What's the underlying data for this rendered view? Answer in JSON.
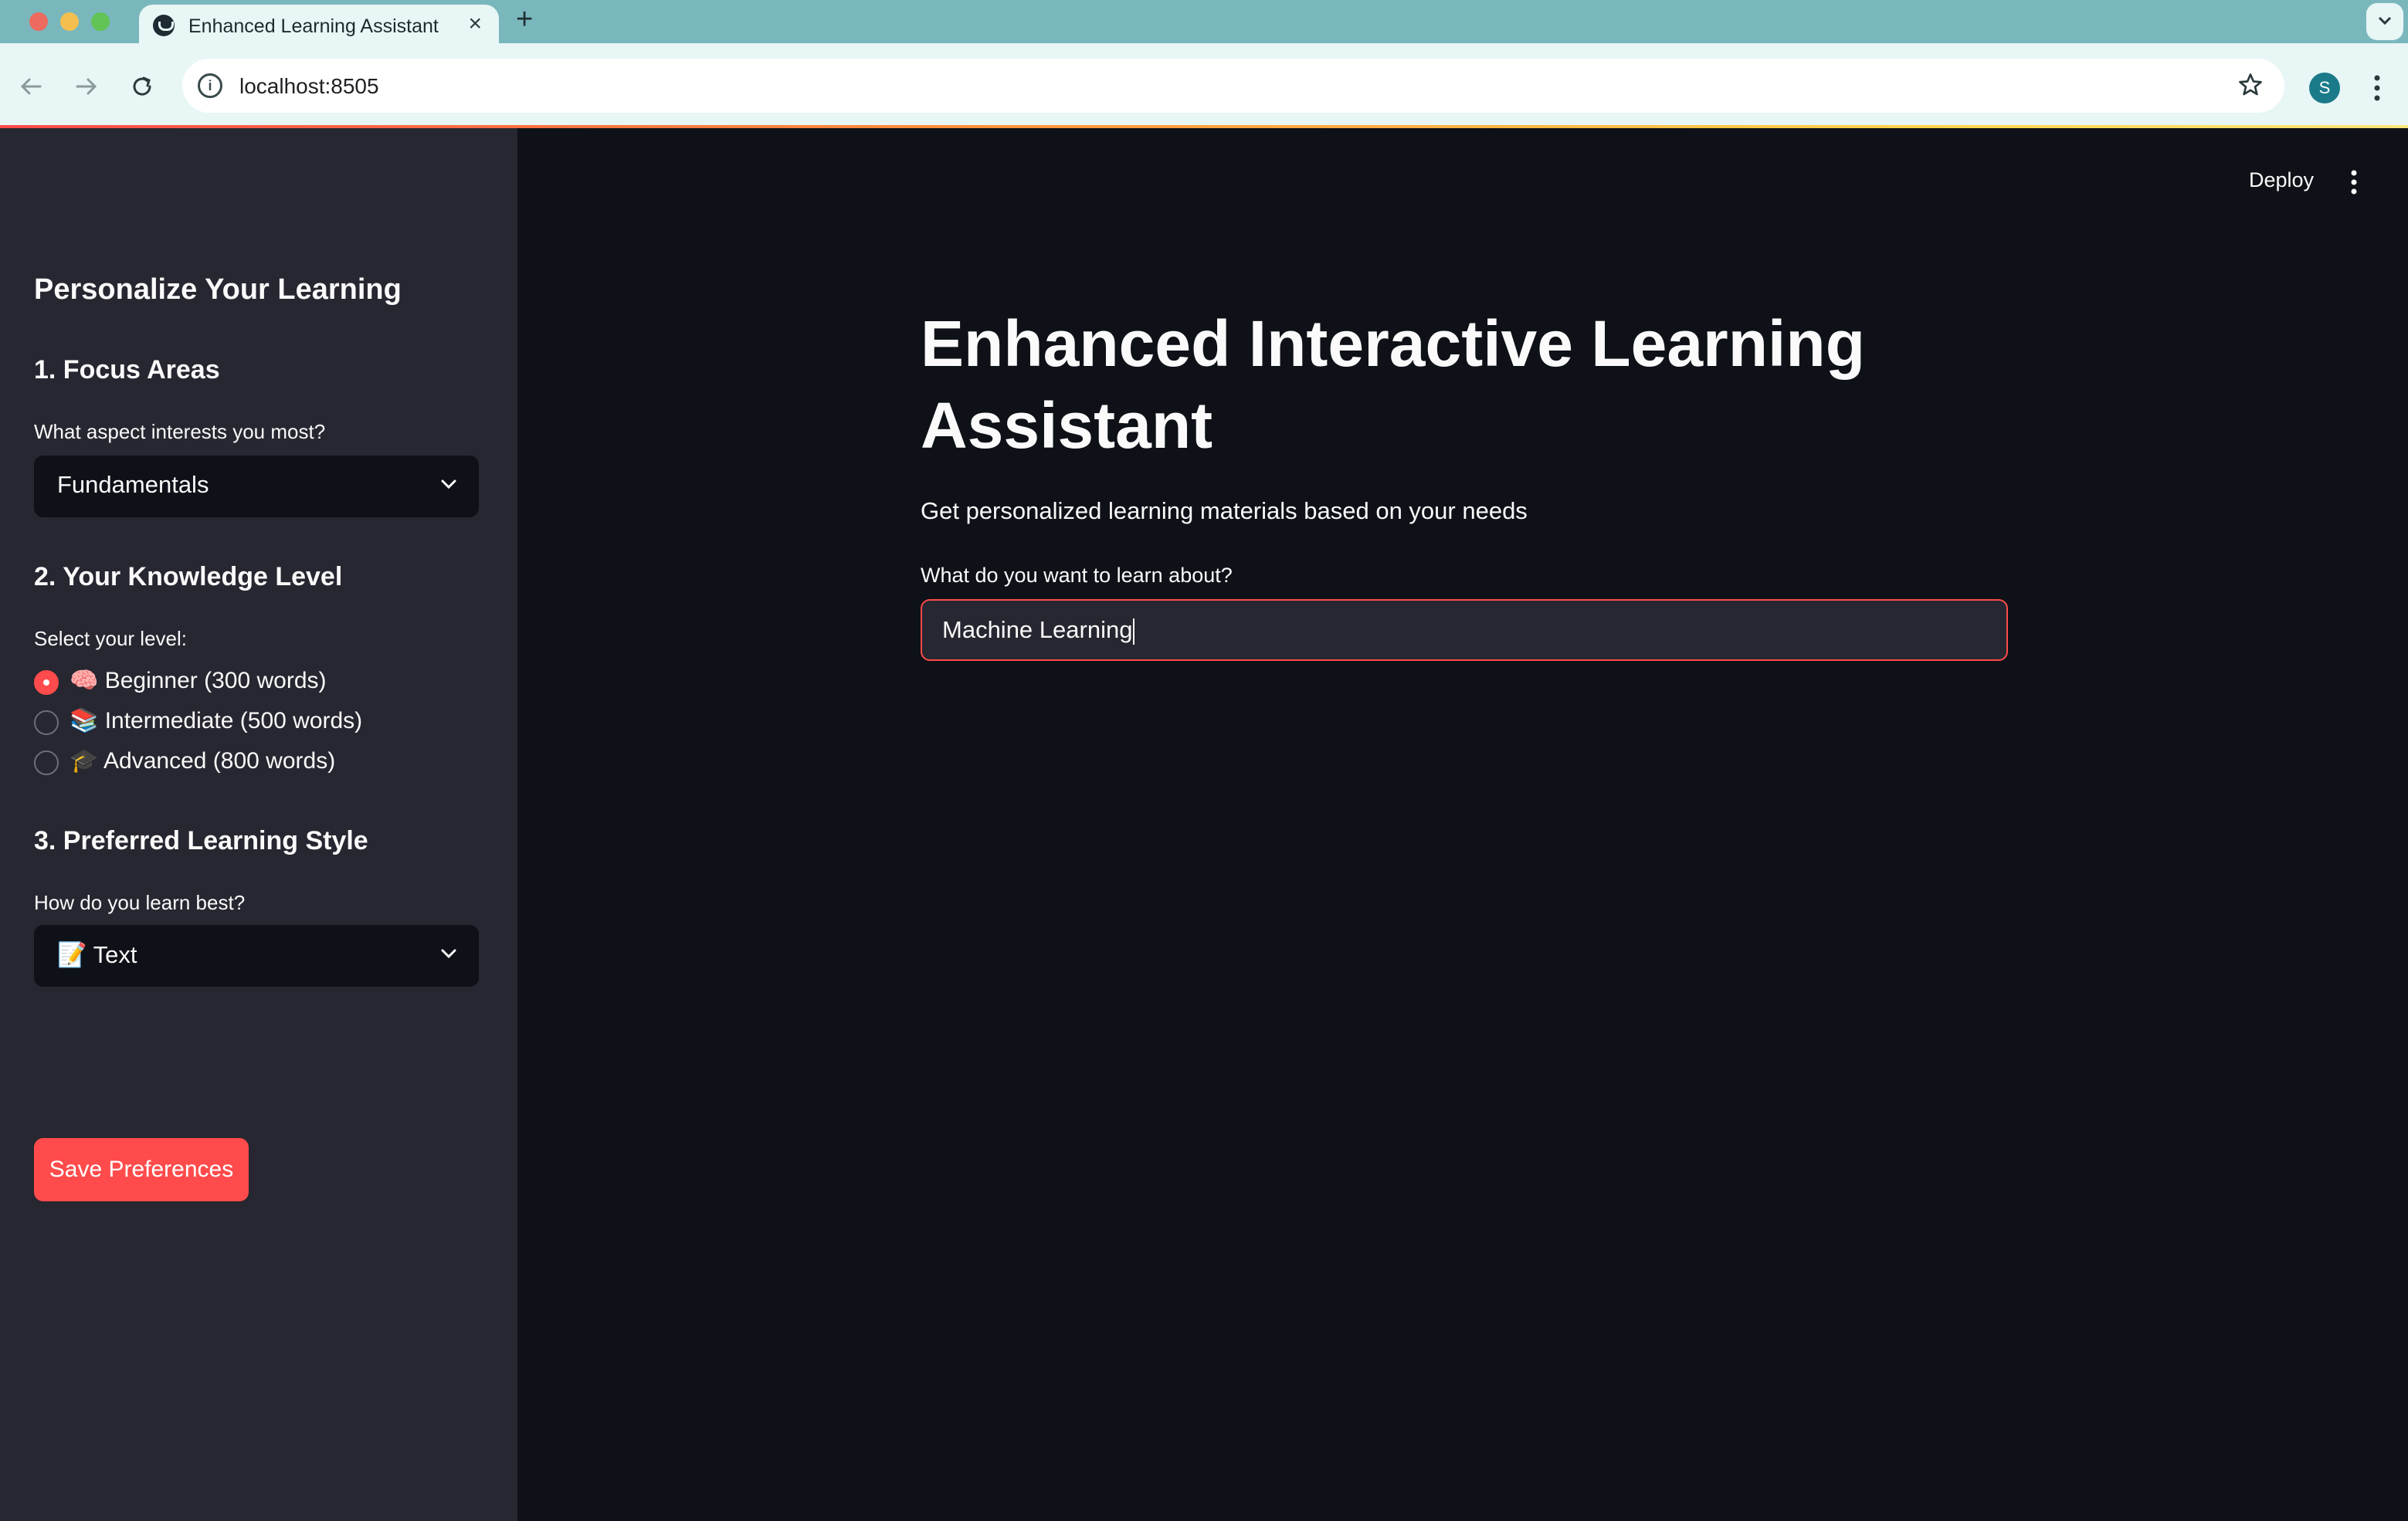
{
  "browser": {
    "tab_title": "Enhanced Learning Assistant",
    "url": "localhost:8505",
    "profile_initial": "S",
    "icons": [
      "back-icon",
      "forward-icon",
      "reload-icon",
      "info-icon",
      "star-icon",
      "menu-icon",
      "tab-search-icon"
    ]
  },
  "sidebar": {
    "title": "Personalize Your Learning",
    "focus": {
      "heading": "1. Focus Areas",
      "label": "What aspect interests you most?",
      "value": "Fundamentals"
    },
    "level": {
      "heading": "2. Your Knowledge Level",
      "label": "Select your level:",
      "options": [
        {
          "label": "🧠 Beginner (300 words)",
          "checked": true
        },
        {
          "label": "📚 Intermediate (500 words)",
          "checked": false
        },
        {
          "label": "🎓 Advanced (800 words)",
          "checked": false
        }
      ]
    },
    "style": {
      "heading": "3. Preferred Learning Style",
      "label": "How do you learn best?",
      "value": "📝 Text"
    },
    "save_label": "Save Preferences"
  },
  "main": {
    "deploy_label": "Deploy",
    "title": "Enhanced Interactive Learning Assistant",
    "subtitle": "Get personalized learning materials based on your needs",
    "input_label": "What do you want to learn about?",
    "input_value": "Machine Learning"
  },
  "colors": {
    "accent": "#ff4b4b",
    "sidebar_bg": "#262730",
    "main_bg": "#0e1117",
    "tabbar_bg": "#79b7bd"
  }
}
